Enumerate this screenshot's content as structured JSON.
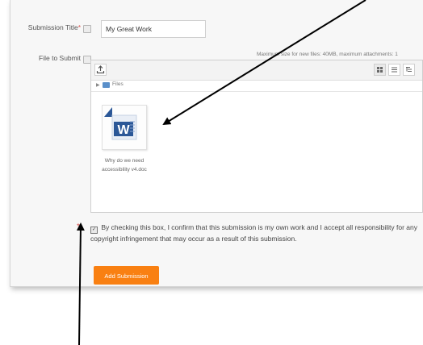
{
  "form": {
    "title_label": "Submission Title",
    "required_marker": "*",
    "title_value": "My Great Work",
    "file_label": "File to Submit",
    "max_info": "Maximum size for new files: 40MB, maximum attachments: 1",
    "breadcrumb": "Files",
    "file_name": "Why do we need accessibility v4.doc",
    "confirm_text": "By checking this box, I confirm that this submission is my own work and I accept all responsibility for any copyright infringement that may occur as a result of this submission.",
    "submit_label": "Add Submission",
    "word_letter": "W"
  },
  "icons": {
    "help": "help-icon",
    "upload": "upload-icon",
    "folder": "folder-icon",
    "view_icons": "grid-view-icon",
    "view_list": "list-view-icon",
    "view_tree": "tree-view-icon",
    "word": "word-document-icon"
  },
  "colors": {
    "accent": "#f98012",
    "required": "#d9534f",
    "word_blue": "#2b5797"
  }
}
